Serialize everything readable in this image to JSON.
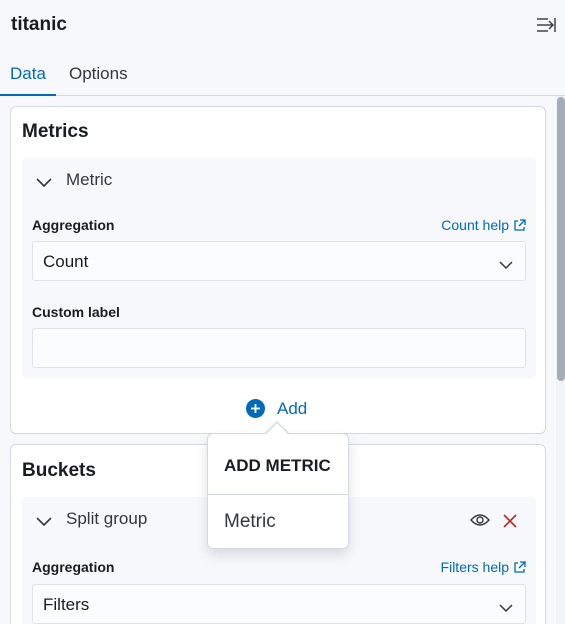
{
  "header": {
    "title": "titanic",
    "collapse_icon": "menu-collapse-icon"
  },
  "tabs": [
    {
      "label": "Data",
      "active": true
    },
    {
      "label": "Options",
      "active": false
    }
  ],
  "metrics": {
    "title": "Metrics",
    "accordion_label": "Metric",
    "aggregation_label": "Aggregation",
    "help_link": "Count help",
    "aggregation_value": "Count",
    "custom_label_label": "Custom label",
    "custom_label_value": "",
    "add_label": "Add"
  },
  "buckets": {
    "title": "Buckets",
    "accordion_label": "Split group",
    "aggregation_label": "Aggregation",
    "help_link": "Filters help",
    "aggregation_value": "Filters"
  },
  "popover": {
    "title": "ADD METRIC",
    "items": [
      "Metric"
    ]
  },
  "colors": {
    "accent": "#006bb8",
    "danger": "#bd271e",
    "background": "#f7f8fc"
  }
}
